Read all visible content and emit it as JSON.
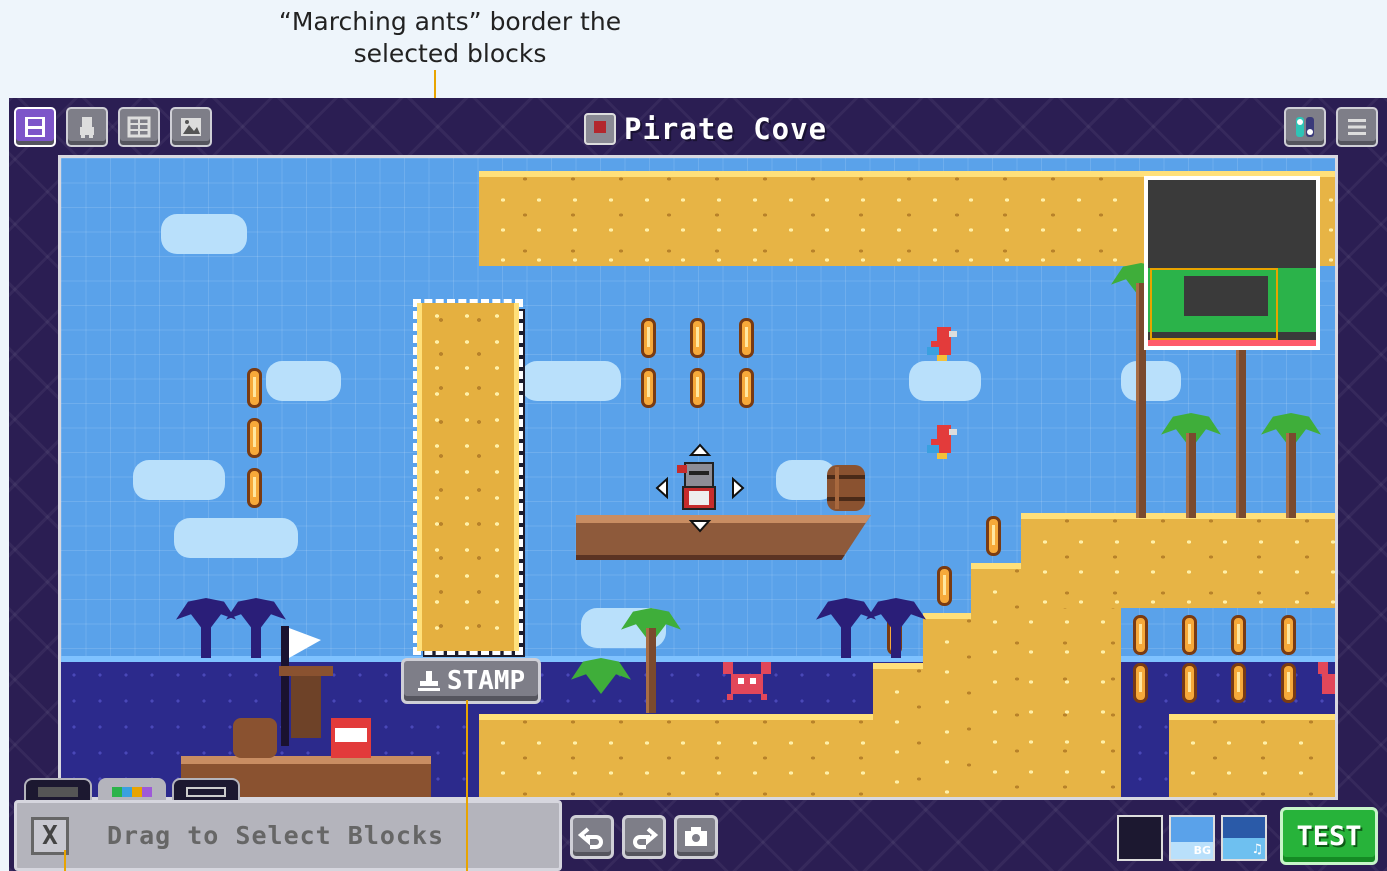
{
  "annotations": {
    "marching_ants": "“Marching ants” border the\nselected blocks"
  },
  "header": {
    "title": "Pirate Cove",
    "tool_buttons": [
      {
        "name": "blocks-tool",
        "icon": "save-disk-icon",
        "active": true
      },
      {
        "name": "characters-tool",
        "icon": "character-icon",
        "active": false
      },
      {
        "name": "tiles-tool",
        "icon": "grid-icon",
        "active": false
      },
      {
        "name": "background-tool",
        "icon": "image-icon",
        "active": false
      }
    ],
    "right_buttons": [
      {
        "name": "settings-toggle",
        "icon": "toggle-icon"
      },
      {
        "name": "menu",
        "icon": "hamburger-icon"
      }
    ]
  },
  "editor": {
    "stamp_label": "STAMP",
    "status_message": "Drag to Select Blocks",
    "close_label": "X",
    "test_label": "TEST",
    "thumbnails": [
      {
        "name": "level-thumb",
        "label": ""
      },
      {
        "name": "bg-thumb",
        "label": "BG"
      },
      {
        "name": "music-thumb",
        "label": "♫"
      }
    ]
  },
  "colors": {
    "frame": "#2b1e53",
    "sky": "#5aa2ea",
    "ground": "#e7b445",
    "selected_tool": "#7d55c9",
    "test_button": "#27b33a",
    "annotation_line": "#e8a400"
  }
}
